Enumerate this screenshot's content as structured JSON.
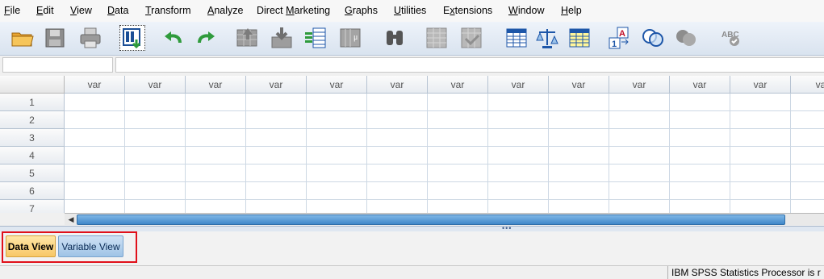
{
  "menu": [
    {
      "label": "File"
    },
    {
      "label": "Edit"
    },
    {
      "label": "View"
    },
    {
      "label": "Data"
    },
    {
      "label": "Transform"
    },
    {
      "label": "Analyze"
    },
    {
      "label": "Direct Marketing"
    },
    {
      "label": "Graphs"
    },
    {
      "label": "Utilities"
    },
    {
      "label": "Extensions"
    },
    {
      "label": "Window"
    },
    {
      "label": "Help"
    }
  ],
  "toolbar_icons": [
    "open-folder-icon",
    "save-icon",
    "print-icon",
    "recall-dialog-icon",
    "undo-icon",
    "redo-icon",
    "goto-case-icon",
    "goto-variable-icon",
    "variables-icon",
    "run-descriptives-icon",
    "find-icon",
    "insert-cases-icon",
    "insert-variable-icon",
    "split-file-icon",
    "weight-cases-icon",
    "select-cases-icon",
    "value-labels-icon",
    "use-sets-icon",
    "show-all-variables-icon",
    "spell-check-icon"
  ],
  "grid": {
    "column_header": "var",
    "visible_last_header": "va",
    "rows": [
      "1",
      "2",
      "3",
      "4",
      "5",
      "6",
      "7"
    ]
  },
  "tabs": {
    "data_view": "Data View",
    "variable_view": "Variable View"
  },
  "status": {
    "text": "IBM SPSS Statistics Processor is r"
  },
  "colors": {
    "accent_tab_active": "#f8c766",
    "accent_tab_inactive": "#9ec3e6",
    "highlight_box": "#e0101a",
    "scroll_thumb": "#3f88c9"
  }
}
